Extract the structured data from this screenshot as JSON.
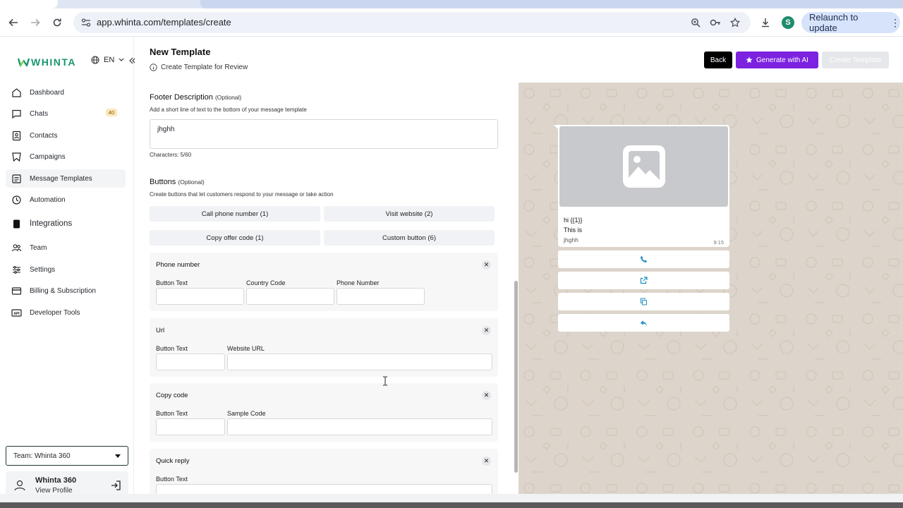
{
  "browser": {
    "url": "app.whinta.com/templates/create",
    "profile_initial": "S",
    "relaunch_label": "Relaunch to update"
  },
  "sidebar": {
    "logo_text": "WHINTA",
    "language": "EN",
    "items": [
      {
        "label": "Dashboard",
        "icon": "home-icon"
      },
      {
        "label": "Chats",
        "icon": "chat-icon",
        "badge": "40"
      },
      {
        "label": "Contacts",
        "icon": "contacts-icon"
      },
      {
        "label": "Campaigns",
        "icon": "campaigns-icon"
      },
      {
        "label": "Message Templates",
        "icon": "template-icon"
      },
      {
        "label": "Automation",
        "icon": "automation-icon"
      },
      {
        "label": "Integrations",
        "icon": "integrations-icon"
      },
      {
        "label": "Team",
        "icon": "team-icon"
      },
      {
        "label": "Settings",
        "icon": "settings-icon"
      },
      {
        "label": "Billing & Subscription",
        "icon": "billing-icon"
      },
      {
        "label": "Developer Tools",
        "icon": "api-icon"
      }
    ],
    "team_select": "Team: Whinta 360",
    "profile": {
      "name": "Whinta 360",
      "sub": "View Profile"
    }
  },
  "header": {
    "title": "New Template",
    "subtitle": "Create Template for Review",
    "back": "Back",
    "generate_ai": "Generate with AI",
    "create": "Create Template"
  },
  "form": {
    "footer": {
      "title": "Footer Description",
      "optional": "(Optional)",
      "desc": "Add a short line of text to the bottom of your message template",
      "value": "jhghh",
      "chars": "Characters: 5/60"
    },
    "buttons": {
      "title": "Buttons",
      "optional": "(Optional)",
      "desc": "Create buttons that let customers respond to your message or take action",
      "options": [
        "Call phone number (1)",
        "Visit website (2)",
        "Copy offer code (1)",
        "Custom button (6)"
      ]
    },
    "cards": {
      "phone": {
        "title": "Phone number",
        "labels": [
          "Button Text",
          "Country Code",
          "Phone Number"
        ]
      },
      "url": {
        "title": "Url",
        "labels": [
          "Button Text",
          "Website URL"
        ]
      },
      "copy": {
        "title": "Copy code",
        "labels": [
          "Button Text",
          "Sample Code"
        ]
      },
      "quick": {
        "title": "Quick reply",
        "labels": [
          "Button Text"
        ]
      }
    }
  },
  "preview": {
    "body_line1": "hi {{1}}",
    "body_line2": "This is",
    "footer": "jhghh",
    "time": "9:15",
    "accent": "#1f8ec4"
  }
}
